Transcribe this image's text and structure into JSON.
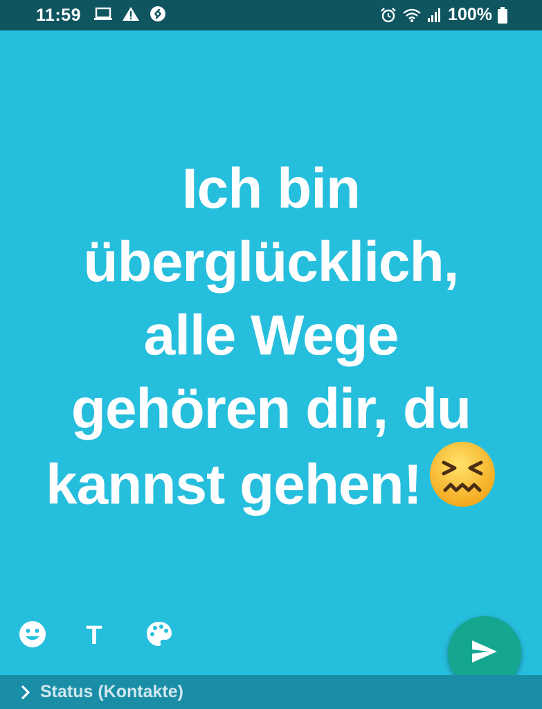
{
  "status_bar": {
    "time": "11:59",
    "battery": "100%",
    "left_icons": [
      "laptop-icon",
      "warning-icon",
      "shazam-icon"
    ],
    "right_icons": [
      "alarm-icon",
      "wifi-icon",
      "signal-icon",
      "battery-icon"
    ]
  },
  "status_text": {
    "lines": [
      "Ich bin",
      "überglücklich,",
      "alle Wege",
      "gehören dir, du",
      "kannst gehen!"
    ],
    "emoji": "confounded-face-emoji",
    "text_color": "#ffffff",
    "background_color": "#26bedd"
  },
  "tools": {
    "text_tool_label": "T",
    "items": [
      "emoji-icon",
      "text-tool",
      "palette-icon"
    ]
  },
  "send_button": {
    "icon": "send-icon",
    "color": "#15a690"
  },
  "audience": {
    "label": "Status (Kontakte)"
  }
}
